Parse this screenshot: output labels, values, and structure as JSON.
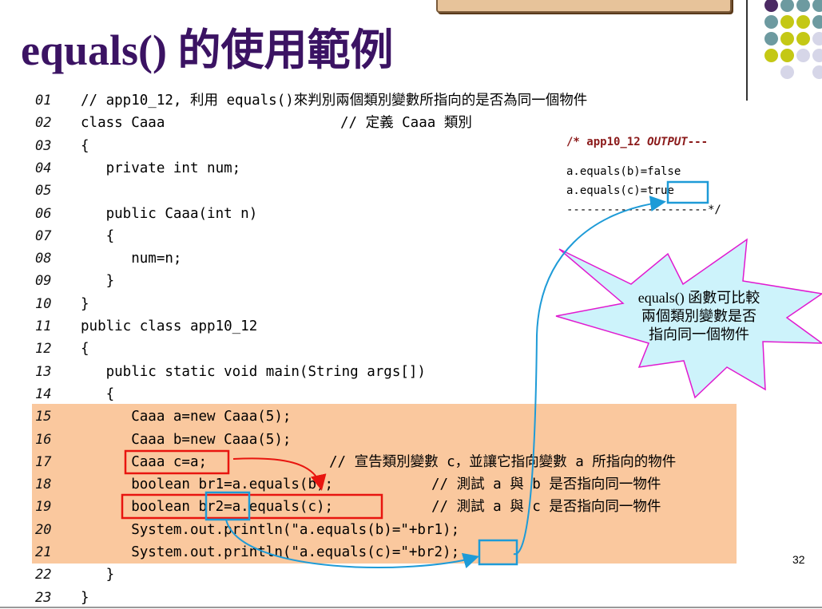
{
  "slide": {
    "title": "equals() 的使用範例",
    "page_number": "32"
  },
  "code": [
    {
      "no": "01",
      "text": "// app10_12, 利用 equals()來判別兩個類別變數所指向的是否為同一個物件",
      "comment": ""
    },
    {
      "no": "02",
      "text": "class Caaa",
      "comment": "// 定義 Caaa 類別"
    },
    {
      "no": "03",
      "text": "{",
      "comment": ""
    },
    {
      "no": "04",
      "text": "   private int num;",
      "comment": ""
    },
    {
      "no": "05",
      "text": "",
      "comment": ""
    },
    {
      "no": "06",
      "text": "   public Caaa(int n)",
      "comment": ""
    },
    {
      "no": "07",
      "text": "   {",
      "comment": ""
    },
    {
      "no": "08",
      "text": "      num=n;",
      "comment": ""
    },
    {
      "no": "09",
      "text": "   }",
      "comment": ""
    },
    {
      "no": "10",
      "text": "}",
      "comment": ""
    },
    {
      "no": "11",
      "text": "public class app10_12",
      "comment": ""
    },
    {
      "no": "12",
      "text": "{",
      "comment": ""
    },
    {
      "no": "13",
      "text": "   public static void main(String args[])",
      "comment": ""
    },
    {
      "no": "14",
      "text": "   {",
      "comment": ""
    },
    {
      "no": "15",
      "text": "      Caaa a=new Caaa(5);",
      "comment": ""
    },
    {
      "no": "16",
      "text": "      Caaa b=new Caaa(5);",
      "comment": ""
    },
    {
      "no": "17",
      "text": "      Caaa c=a;",
      "comment": "// 宣告類別變數 c，並讓它指向變數 a 所指向的物件"
    },
    {
      "no": "18",
      "text": "      boolean br1=a.equals(b);",
      "comment": "// 測試 a 與 b 是否指向同一物件"
    },
    {
      "no": "19",
      "text": "      boolean br2=a.equals(c);",
      "comment": "// 測試 a 與 c 是否指向同一物件"
    },
    {
      "no": "20",
      "text": "      System.out.println(\"a.equals(b)=\"+br1);",
      "comment": ""
    },
    {
      "no": "21",
      "text": "      System.out.println(\"a.equals(c)=\"+br2);",
      "comment": ""
    },
    {
      "no": "22",
      "text": "   }",
      "comment": ""
    },
    {
      "no": "23",
      "text": "}",
      "comment": ""
    }
  ],
  "output": {
    "header_prefix": "/* app10_12 ",
    "header_keyword": "OUTPUT",
    "header_suffix": "---",
    "line1": "a.equals(b)=false",
    "line2_prefix": "a.equals(c)=",
    "line2_value": "true",
    "footer": "---------------------*/"
  },
  "callout": {
    "line1": "equals() 函數可比較",
    "line2": "兩個類別變數是否",
    "line3": "指向同一個物件"
  },
  "colors": {
    "title": "#3b1363",
    "highlight": "#fac89e",
    "red_box": "#e8150f",
    "blue_box": "#1e9bd7",
    "star_fill": "#cdf3fb",
    "star_stroke": "#e01ad0",
    "dot_teal": "#6d9aa0",
    "dot_olive": "#c4c815",
    "dot_lavender": "#d6d6e8",
    "dot_purple": "#4b2a63"
  }
}
